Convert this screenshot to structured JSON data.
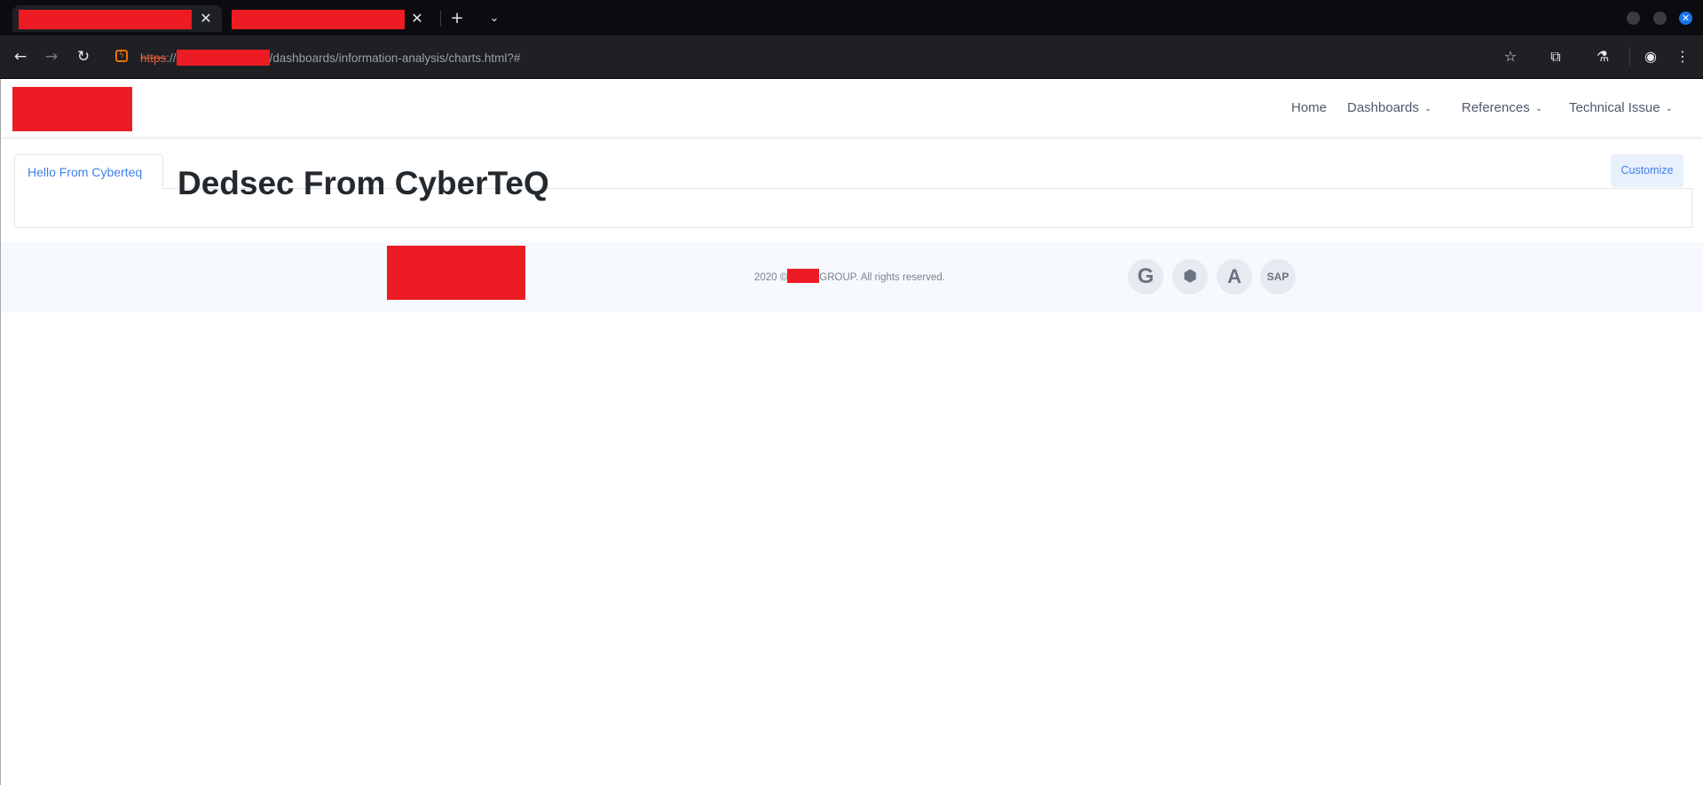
{
  "browser": {
    "tabs": [
      {
        "title_redacted": true,
        "active": true
      },
      {
        "title_redacted": true,
        "active": false
      }
    ],
    "url": {
      "scheme": "https",
      "separator": "://",
      "path": "/dashboards/information-analysis/charts.html?#"
    }
  },
  "site": {
    "nav": {
      "home": "Home",
      "dashboards": "Dashboards",
      "references": "References",
      "technical_issue": "Technical Issue"
    },
    "tab_label": "Hello From Cyberteq",
    "heading": "Dedsec From CyberTeQ",
    "customize_label": "Customize",
    "footer": {
      "copyright_prefix": "2020 ©",
      "copyright_suffix": "GROUP. All rights reserved.",
      "social": [
        {
          "icon": "google-icon",
          "glyph": "G"
        },
        {
          "icon": "android-icon",
          "glyph": "🤖"
        },
        {
          "icon": "adobe-icon",
          "glyph": "A"
        },
        {
          "icon": "sap-icon",
          "glyph": "SAP"
        }
      ]
    }
  },
  "colors": {
    "accent": "#3f80ea",
    "redaction": "#ed1c24",
    "chrome_dark": "#1f2024"
  }
}
